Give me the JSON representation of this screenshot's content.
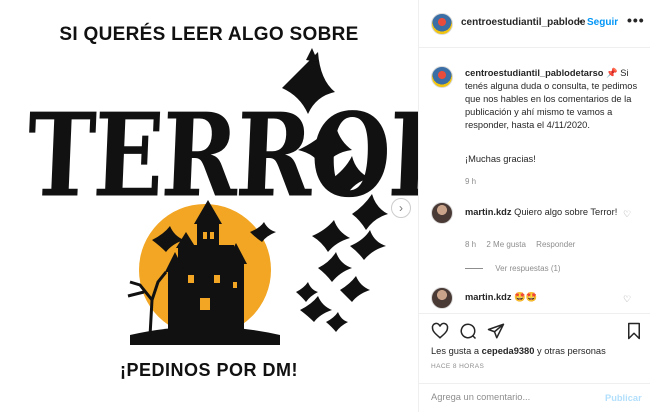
{
  "media": {
    "headline": "SI QUERÉS LEER ALGO SOBRE",
    "title": "TERROR",
    "cta": "¡PEDINOS POR DM!"
  },
  "header": {
    "username": "centroestudiantil_pablode",
    "separator": "•",
    "follow_label": "Seguir",
    "more_label": "•••"
  },
  "caption": {
    "username": "centroestudiantil_pablodetarso",
    "pin_emoji": "📌",
    "text": "Si tenés alguna duda o consulta, te pedimos que nos hables en los comentarios de la publicación y ahí mismo te vamos a responder, hasta el 4/11/2020.",
    "thanks": "¡Muchas gracias!",
    "time": "9 h"
  },
  "comments": [
    {
      "username": "martin.kdz",
      "text": "Quiero algo sobre Terror!",
      "time": "8 h",
      "likes": "2 Me gusta",
      "reply_label": "Responder",
      "view_replies": "Ver respuestas (1)"
    },
    {
      "username": "martin.kdz",
      "text": "🤩🤩"
    }
  ],
  "actions": {
    "likes_prefix": "Les gusta a",
    "likes_user": "cepeda9380",
    "likes_suffix": "y otras personas",
    "post_time": "HACE 8 HORAS"
  },
  "add_comment": {
    "placeholder": "Agrega un comentario...",
    "publish_label": "Publicar"
  },
  "colors": {
    "link_blue": "#0095f6",
    "moon": "#f2a623",
    "secondary_text": "#8e8e8e"
  },
  "icons": [
    "like-heart-icon",
    "comment-icon",
    "share-icon",
    "save-bookmark-icon",
    "like-small-icon",
    "next-arrow-icon",
    "more-options-icon"
  ]
}
